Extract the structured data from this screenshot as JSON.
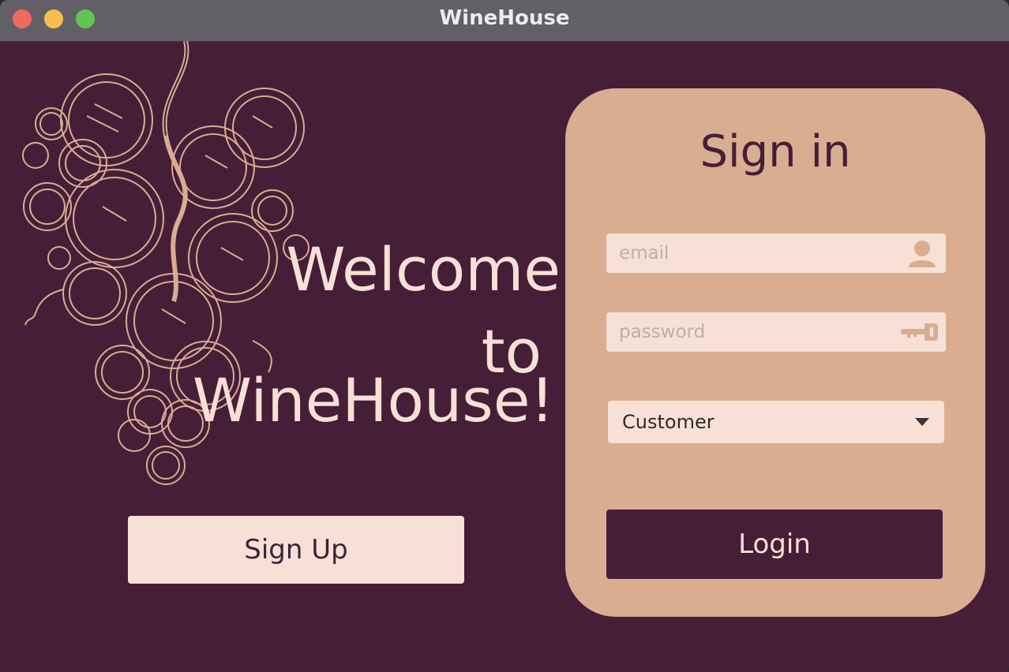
{
  "window": {
    "title": "WineHouse"
  },
  "colors": {
    "background": "#461e38",
    "card": "#d9ad90",
    "input": "#f7e1d6",
    "accent_text": "#f7e1d6",
    "grape_line": "#d9ad90"
  },
  "welcome": {
    "line1": "Welcome",
    "line2": "to",
    "line3": "WineHouse!"
  },
  "signup": {
    "label": "Sign Up"
  },
  "signin": {
    "title": "Sign in",
    "email": {
      "placeholder": "email",
      "value": "",
      "icon": "user-icon"
    },
    "password": {
      "placeholder": "password",
      "value": "",
      "icon": "key-icon"
    },
    "role_select": {
      "selected": "Customer",
      "icon": "chevron-down-icon"
    },
    "login_label": "Login"
  },
  "decoration": {
    "illustration": "grapes-illustration"
  }
}
